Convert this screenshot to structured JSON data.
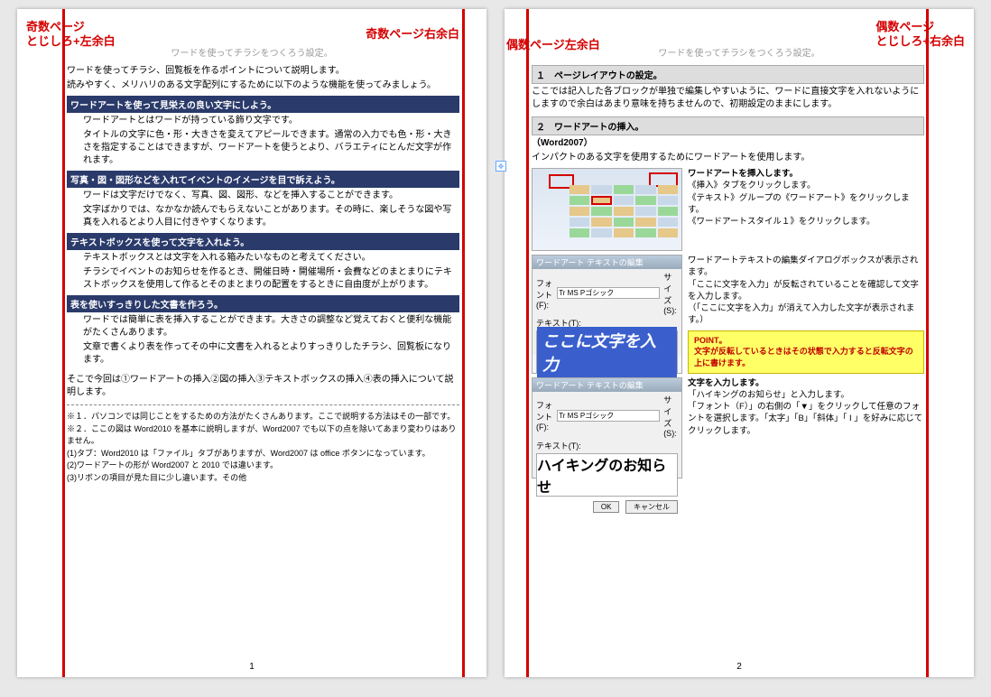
{
  "annotations": {
    "odd_page": "奇数ページ\nとじしろ+左余白",
    "odd_right": "奇数ページ右余白",
    "even_left": "偶数ページ左余白",
    "even_page": "偶数ページ\nとじしろ+右余白"
  },
  "page1": {
    "header": "ワードを使ってチラシをつくろう設定。",
    "intro1": "ワードを使ってチラシ、回覧板を作るポイントについて説明します。",
    "intro2": "読みやすく、メリハリのある文字配列にするために以下のような機能を使ってみましょう。",
    "s1_title": "ワードアートを使って見栄えの良い文字にしよう。",
    "s1_b1": "ワードアートとはワードが持っている飾り文字です。",
    "s1_b2": "タイトルの文字に色・形・大きさを変えてアピールできます。通常の入力でも色・形・大きさを指定することはできますが、ワードアートを使うとより、バラエティにとんだ文字が作れます。",
    "s2_title": "写真・図・図形などを入れてイベントのイメージを目で訴えよう。",
    "s2_b1": "ワードは文字だけでなく、写真、図、図形、などを挿入することができます。",
    "s2_b2": "文字ばかりでは、なかなか読んでもらえないことがあります。その時に、楽しそうな図や写真を入れるとより人目に付きやすくなります。",
    "s3_title": "テキストボックスを使って文字を入れよう。",
    "s3_b1": "テキストボックスとは文字を入れる箱みたいなものと考えてください。",
    "s3_b2": "チラシでイベントのお知らせを作るとき、開催日時・開催場所・会費などのまとまりにテキストボックスを使用して作るとそのまとまりの配置をするときに自由度が上がります。",
    "s4_title": "表を使いすっきりした文書を作ろう。",
    "s4_b1": "ワードでは簡単に表を挿入することができます。大きさの調整など覚えておくと便利な機能がたくさんあります。",
    "s4_b2": "文章で書くより表を作ってその中に文書を入れるとよりすっきりしたチラシ、回覧板になります。",
    "summary": "そこで今回は①ワードアートの挿入②図の挿入③テキストボックスの挿入④表の挿入について説明します。",
    "n1": "※１．パソコンでは同じことをするための方法がたくさんあります。ここで説明する方法はその一部です。",
    "n2": "※２．ここの図は Word2010 を基本に説明しますが、Word2007 でも以下の点を除いてあまり変わりはありません。",
    "n3": "(1)タブ：Word2010 は「ファイル」タブがありますが、Word2007 は office ボタンになっています。",
    "n4": "(2)ワードアートの形が Word2007 と 2010 では違います。",
    "n5": "(3)リボンの項目が見た目に少し違います。その他",
    "pagenum": "1"
  },
  "page2": {
    "header": "ワードを使ってチラシをつくろう設定。",
    "sec1_title": "１　ページレイアウトの設定。",
    "sec1_body": "ここでは記入した各ブロックが単独で編集しやすいように、ワードに直接文字を入れないようにしますので余白はあまり意味を持ちませんので、初期設定のままにします。",
    "sec2_title": "２　ワードアートの挿入。",
    "sec2_sub": "（Word2007）",
    "sec2_body": "インパクトのある文字を使用するためにワードアートを使用します。",
    "r1_title": "ワードアートを挿入します。",
    "r1_l1": "《挿入》タブをクリックします。",
    "r1_l2": "《テキスト》グループの《ワードアート》をクリックします。",
    "r1_l3": "《ワードアートスタイル１》をクリックします。",
    "r2_l1": "ワードアートテキストの編集ダイアログボックスが表示されます。",
    "r2_l2": "「ここに文字を入力」が反転されていることを確認して文字を入力します。",
    "r2_l3": "（「ここに文字を入力」が消えて入力した文字が表示されます。）",
    "point_title": "POINT。",
    "point_body": "文字が反転しているときはその状態で入力すると反転文字の上に書けます。",
    "r3_title": "文字を入力します。",
    "r3_l1": "「ハイキングのお知らせ」と入力します。",
    "r3_l2": "「フォント（F）」の右側の「▼」をクリックして任意のフォントを選択します。「太字」「B」「斜体」「 I 」を好みに応じてクリックします。",
    "dlg_title": "ワードアート テキストの編集",
    "dlg_font_lbl": "フォント(F):",
    "dlg_font_val": "Tr MS Pゴシック",
    "dlg_size_lbl": "サイズ(S):",
    "dlg_text_lbl": "テキスト(T):",
    "dlg_text1": "ここに文字を入力",
    "dlg_text2": "ハイキングのお知らせ",
    "dlg_ok": "OK",
    "dlg_cancel": "キャンセル",
    "pagenum": "2"
  }
}
